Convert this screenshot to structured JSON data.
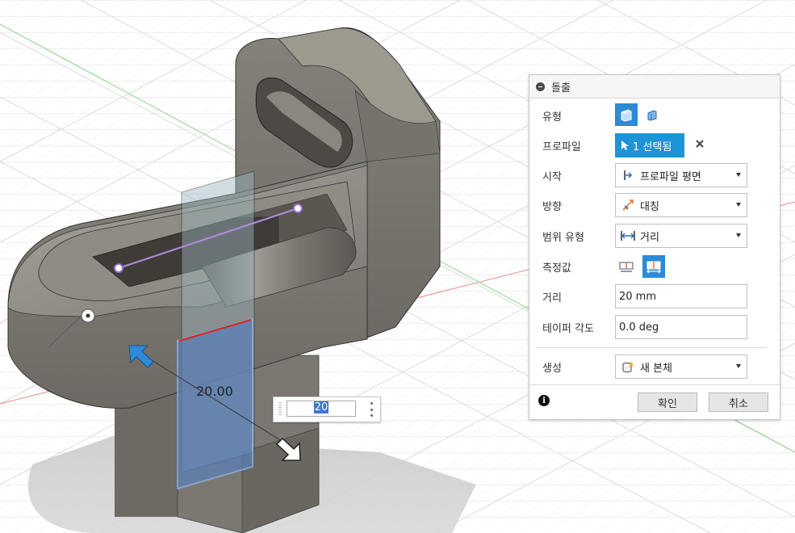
{
  "viewport": {
    "dimension_label": "20.00",
    "dimension_input_value": "20"
  },
  "dialog": {
    "title": "돌출",
    "rows": {
      "type_label": "유형",
      "profile_label": "프로파일",
      "profile_selection": "1 선택됨",
      "start_label": "시작",
      "start_value": "프로파일 평면",
      "direction_label": "방향",
      "direction_value": "대칭",
      "extent_type_label": "범위 유형",
      "extent_type_value": "거리",
      "measurement_label": "측정값",
      "distance_label": "거리",
      "distance_value": "20 mm",
      "taper_label": "테이퍼 각도",
      "taper_value": "0.0 deg",
      "operation_label": "생성",
      "operation_value": "새 본체"
    },
    "ok_label": "확인",
    "cancel_label": "취소"
  },
  "colors": {
    "accent": "#1d93d8",
    "extrude_preview": "#5b7fb6",
    "body_gray": "#8a8780"
  }
}
